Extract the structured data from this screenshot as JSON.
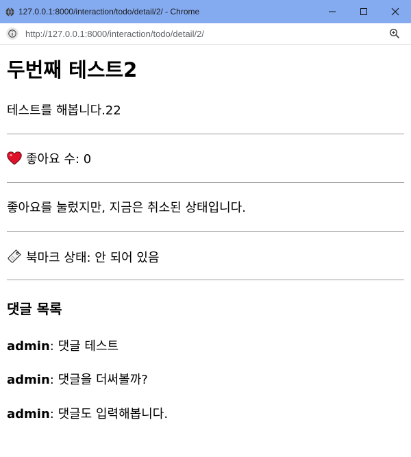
{
  "browser": {
    "window_title": "127.0.0.1:8000/interaction/todo/detail/2/ - Chrome",
    "url": "http://127.0.0.1:8000/interaction/todo/detail/2/"
  },
  "todo": {
    "title": "두번째 테스트2",
    "description": "테스트를 해봅니다.22",
    "like_label": "좋아요 수: 0",
    "like_status": "좋아요를 눌렀지만, 지금은 취소된 상태입니다.",
    "bookmark_label": "북마크 상태: 안 되어 있음"
  },
  "comments": {
    "heading": "댓글 목록",
    "items": [
      {
        "author": "admin",
        "text": ": 댓글 테스트"
      },
      {
        "author": "admin",
        "text": ": 댓글을 더써볼까?"
      },
      {
        "author": "admin",
        "text": ": 댓글도 입력해봅니다."
      }
    ]
  },
  "icons": {
    "like": "heart-icon",
    "bookmark": "bookmark-tag-icon"
  },
  "colors": {
    "titlebar": "#84aaf0",
    "heart": "#e0102a",
    "divider": "#9a9a9a"
  }
}
